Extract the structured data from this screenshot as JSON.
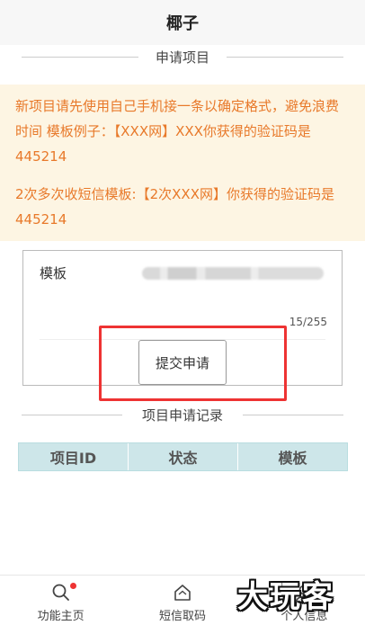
{
  "app": {
    "title": "椰子"
  },
  "apply_section": {
    "title": "申请项目"
  },
  "notice": {
    "line1": "新项目请先使用自己手机接一条以确定格式，避免浪费时间 模板例子：【XXX网】XXX你获得的验证码是445214",
    "line2": "2次多次收短信模板:【2次XXX网】你获得的验证码是445214"
  },
  "form": {
    "template_label": "模板",
    "char_count": "15/255",
    "submit_label": "提交申请"
  },
  "records_section": {
    "title": "项目申请记录"
  },
  "table": {
    "headers": [
      "项目ID",
      "状态",
      "模板"
    ]
  },
  "tabbar": {
    "items": [
      {
        "label": "功能主页",
        "icon": "search-icon"
      },
      {
        "label": "短信取码",
        "icon": "home-icon"
      },
      {
        "label": "个人信息",
        "icon": "user-icon"
      }
    ]
  },
  "watermark": {
    "text": "大玩客"
  },
  "colors": {
    "notice_text": "#e8792a",
    "notice_bg": "#fdf5e3",
    "table_header_bg": "#cde6e9",
    "highlight_box": "#e33333"
  }
}
